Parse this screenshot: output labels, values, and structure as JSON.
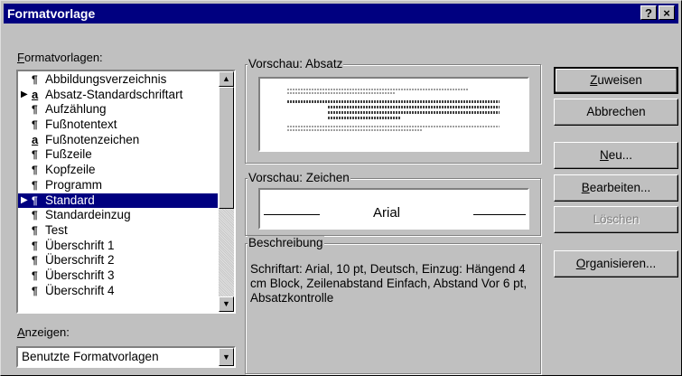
{
  "window": {
    "title": "Formatvorlage",
    "help_glyph": "?",
    "close_glyph": "×"
  },
  "styles_list": {
    "label": "Formatvorlagen:",
    "items": [
      {
        "icon": "¶",
        "text": "Abbildungsverzeichnis",
        "marker": "",
        "selected": false
      },
      {
        "icon": "a",
        "text": "Absatz-Standardschriftart",
        "marker": "▶",
        "selected": false
      },
      {
        "icon": "¶",
        "text": "Aufzählung",
        "marker": "",
        "selected": false
      },
      {
        "icon": "¶",
        "text": "Fußnotentext",
        "marker": "",
        "selected": false
      },
      {
        "icon": "a",
        "text": "Fußnotenzeichen",
        "marker": "",
        "selected": false
      },
      {
        "icon": "¶",
        "text": "Fußzeile",
        "marker": "",
        "selected": false
      },
      {
        "icon": "¶",
        "text": "Kopfzeile",
        "marker": "",
        "selected": false
      },
      {
        "icon": "¶",
        "text": "Programm",
        "marker": "",
        "selected": false
      },
      {
        "icon": "¶",
        "text": "Standard",
        "marker": "▶",
        "selected": true
      },
      {
        "icon": "¶",
        "text": "Standardeinzug",
        "marker": "",
        "selected": false
      },
      {
        "icon": "¶",
        "text": "Test",
        "marker": "",
        "selected": false
      },
      {
        "icon": "¶",
        "text": "Überschrift 1",
        "marker": "",
        "selected": false
      },
      {
        "icon": "¶",
        "text": "Überschrift 2",
        "marker": "",
        "selected": false
      },
      {
        "icon": "¶",
        "text": "Überschrift 3",
        "marker": "",
        "selected": false
      },
      {
        "icon": "¶",
        "text": "Überschrift 4",
        "marker": "",
        "selected": false
      }
    ],
    "scroll_up_glyph": "▲",
    "scroll_down_glyph": "▼"
  },
  "show": {
    "label": "Anzeigen:",
    "value": "Benutzte Formatvorlagen",
    "dropdown_glyph": "▼"
  },
  "preview_paragraph": {
    "title": "Vorschau: Absatz"
  },
  "preview_char": {
    "title": "Vorschau: Zeichen",
    "sample": "Arial"
  },
  "description": {
    "title": "Beschreibung",
    "text": "Schriftart: Arial, 10 pt, Deutsch, Einzug: Hängend  4 cm Block, Zeilenabstand Einfach, Abstand Vor 6 pt, Absatzkontrolle"
  },
  "buttons": {
    "apply": "Zuweisen",
    "cancel": "Abbrechen",
    "new": "Neu...",
    "edit": "Bearbeiten...",
    "delete": "Löschen",
    "organize": "Organisieren..."
  },
  "colors": {
    "titlebar": "#000080",
    "face": "#c0c0c0",
    "selection": "#000080"
  }
}
